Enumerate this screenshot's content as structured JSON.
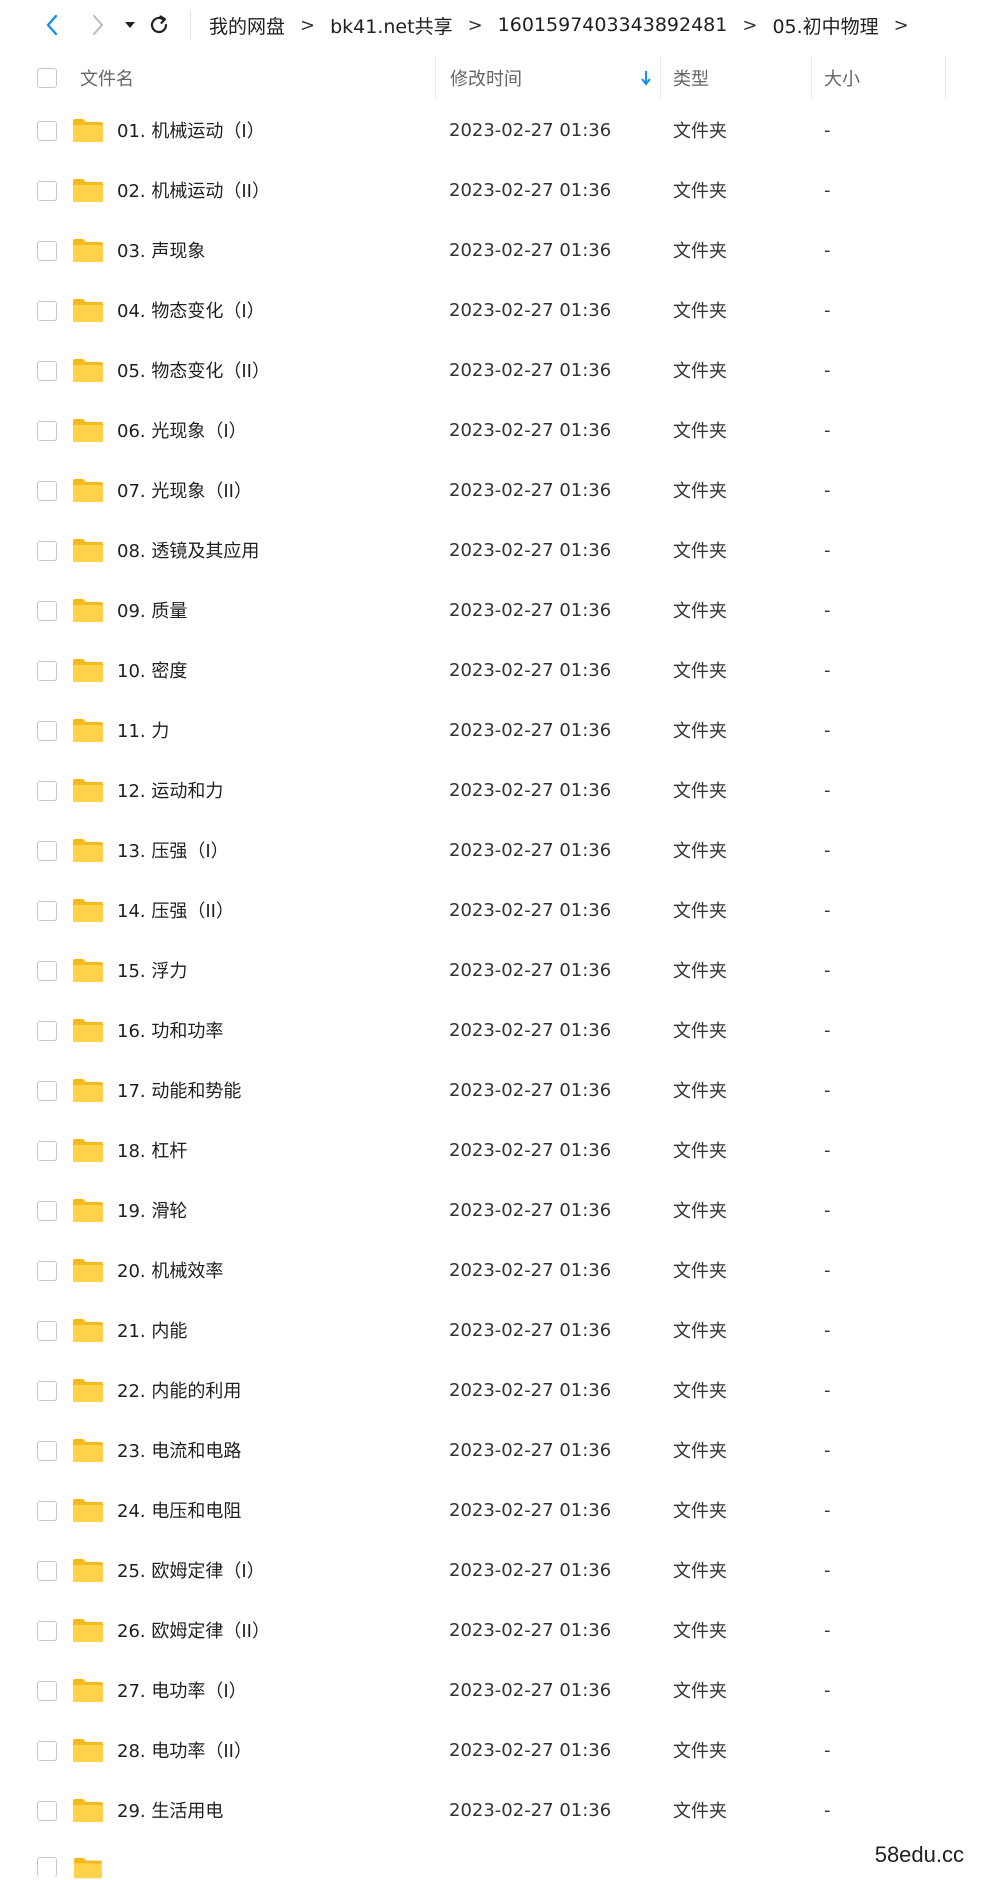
{
  "colors": {
    "accent": "#1a8ef0",
    "folder_body": "#ffd24a",
    "folder_tab": "#f5b920",
    "border": "#c8c8c8"
  },
  "nav": {
    "back_icon": "chevron-left-icon",
    "forward_icon": "chevron-right-icon",
    "dropdown_icon": "caret-down-icon",
    "refresh_icon": "refresh-icon"
  },
  "breadcrumb": {
    "items": [
      "我的网盘",
      "bk41.net共享",
      "1601597403343892481",
      "05.初中物理"
    ],
    "separator": ">"
  },
  "header": {
    "name": "文件名",
    "modified": "修改时间",
    "type": "类型",
    "size": "大小",
    "sort_icon": "arrow-down-icon"
  },
  "files": [
    {
      "name": "01. 机械运动（I）",
      "date": "2023-02-27 01:36",
      "type": "文件夹",
      "size": "-"
    },
    {
      "name": "02. 机械运动（II）",
      "date": "2023-02-27 01:36",
      "type": "文件夹",
      "size": "-"
    },
    {
      "name": "03. 声现象",
      "date": "2023-02-27 01:36",
      "type": "文件夹",
      "size": "-"
    },
    {
      "name": "04. 物态变化（I）",
      "date": "2023-02-27 01:36",
      "type": "文件夹",
      "size": "-"
    },
    {
      "name": "05. 物态变化（II）",
      "date": "2023-02-27 01:36",
      "type": "文件夹",
      "size": "-"
    },
    {
      "name": "06. 光现象（I）",
      "date": "2023-02-27 01:36",
      "type": "文件夹",
      "size": "-"
    },
    {
      "name": "07. 光现象（II）",
      "date": "2023-02-27 01:36",
      "type": "文件夹",
      "size": "-"
    },
    {
      "name": "08. 透镜及其应用",
      "date": "2023-02-27 01:36",
      "type": "文件夹",
      "size": "-"
    },
    {
      "name": "09. 质量",
      "date": "2023-02-27 01:36",
      "type": "文件夹",
      "size": "-"
    },
    {
      "name": "10. 密度",
      "date": "2023-02-27 01:36",
      "type": "文件夹",
      "size": "-"
    },
    {
      "name": "11. 力",
      "date": "2023-02-27 01:36",
      "type": "文件夹",
      "size": "-"
    },
    {
      "name": "12. 运动和力",
      "date": "2023-02-27 01:36",
      "type": "文件夹",
      "size": "-"
    },
    {
      "name": "13. 压强（I）",
      "date": "2023-02-27 01:36",
      "type": "文件夹",
      "size": "-"
    },
    {
      "name": "14. 压强（II）",
      "date": "2023-02-27 01:36",
      "type": "文件夹",
      "size": "-"
    },
    {
      "name": "15. 浮力",
      "date": "2023-02-27 01:36",
      "type": "文件夹",
      "size": "-"
    },
    {
      "name": "16. 功和功率",
      "date": "2023-02-27 01:36",
      "type": "文件夹",
      "size": "-"
    },
    {
      "name": "17. 动能和势能",
      "date": "2023-02-27 01:36",
      "type": "文件夹",
      "size": "-"
    },
    {
      "name": "18. 杠杆",
      "date": "2023-02-27 01:36",
      "type": "文件夹",
      "size": "-"
    },
    {
      "name": "19. 滑轮",
      "date": "2023-02-27 01:36",
      "type": "文件夹",
      "size": "-"
    },
    {
      "name": "20. 机械效率",
      "date": "2023-02-27 01:36",
      "type": "文件夹",
      "size": "-"
    },
    {
      "name": "21. 内能",
      "date": "2023-02-27 01:36",
      "type": "文件夹",
      "size": "-"
    },
    {
      "name": "22. 内能的利用",
      "date": "2023-02-27 01:36",
      "type": "文件夹",
      "size": "-"
    },
    {
      "name": "23. 电流和电路",
      "date": "2023-02-27 01:36",
      "type": "文件夹",
      "size": "-"
    },
    {
      "name": "24. 电压和电阻",
      "date": "2023-02-27 01:36",
      "type": "文件夹",
      "size": "-"
    },
    {
      "name": "25. 欧姆定律（I）",
      "date": "2023-02-27 01:36",
      "type": "文件夹",
      "size": "-"
    },
    {
      "name": "26. 欧姆定律（II）",
      "date": "2023-02-27 01:36",
      "type": "文件夹",
      "size": "-"
    },
    {
      "name": "27. 电功率（I）",
      "date": "2023-02-27 01:36",
      "type": "文件夹",
      "size": "-"
    },
    {
      "name": "28. 电功率（II）",
      "date": "2023-02-27 01:36",
      "type": "文件夹",
      "size": "-"
    },
    {
      "name": "29. 生活用电",
      "date": "2023-02-27 01:36",
      "type": "文件夹",
      "size": "-"
    }
  ],
  "watermark": "58edu.cc"
}
